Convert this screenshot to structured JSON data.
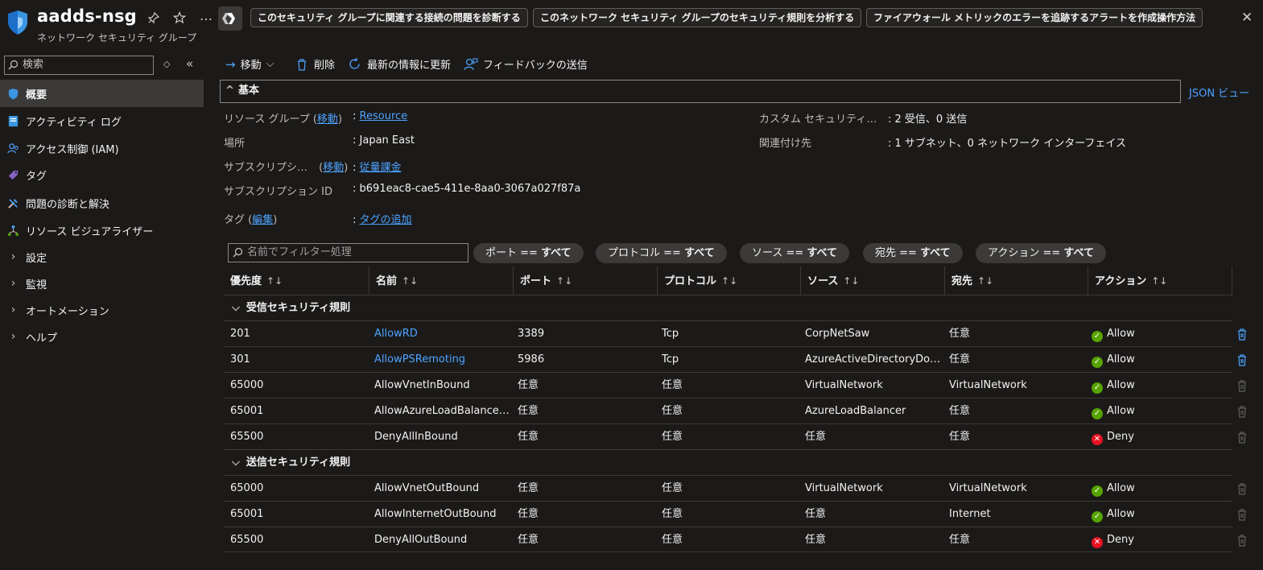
{
  "header": {
    "title": "aadds-nsg",
    "subtitle": "ネットワーク セキュリティ グループ",
    "more": "…",
    "close": "✕",
    "actions": [
      "このセキュリティ グループに関連する接続の問題を診断する",
      "このネットワーク セキュリティ グループのセキュリティ規則を分析する",
      "ファイアウォール メトリックのエラーを追跡するアラートを作成操作方法"
    ]
  },
  "sidebar": {
    "search_placeholder": "検索",
    "items": [
      {
        "label": "概要",
        "icon": "shield-icon"
      },
      {
        "label": "アクティビティ ログ",
        "icon": "activity-log-icon"
      },
      {
        "label": "アクセス制御 (IAM)",
        "icon": "iam-icon"
      },
      {
        "label": "タグ",
        "icon": "tag-icon"
      },
      {
        "label": "問題の診断と解決",
        "icon": "wrench-icon"
      },
      {
        "label": "リソース ビジュアライザー",
        "icon": "visualizer-icon"
      },
      {
        "label": "設定",
        "icon": "chevron-right-icon"
      },
      {
        "label": "監視",
        "icon": "chevron-right-icon"
      },
      {
        "label": "オートメーション",
        "icon": "chevron-right-icon"
      },
      {
        "label": "ヘルプ",
        "icon": "chevron-right-icon"
      }
    ]
  },
  "toolbar": {
    "move": "移動",
    "delete": "削除",
    "refresh": "最新の情報に更新",
    "feedback": "フィードバックの送信"
  },
  "essentials": {
    "title": "基本",
    "json_view": "JSON ビュー",
    "resource_group_label": "リソース グループ (",
    "move_link": "移動",
    "label_close": ")",
    "resource_group_value": "Resource",
    "location_label": "場所",
    "location_value": "Japan East",
    "subscription_label": "サブスクリプシ…",
    "subscription_move": "移動",
    "subscription_value": "従量課金",
    "subscription_id_label": "サブスクリプション ID",
    "subscription_id_value": "b691eac8-cae5-411e-8aa0-3067a027f87a",
    "tags_label": "タグ (",
    "tags_edit": "編集",
    "tags_value": "タグの追加",
    "custom_rules_label": "カスタム セキュリティ…",
    "custom_rules_value": "2 受信、0 送信",
    "associated_label": "関連付け先",
    "associated_value": "1 サブネット、0 ネットワーク インターフェイス",
    "colon": ":"
  },
  "filters": {
    "placeholder": "名前でフィルター処理",
    "pills": [
      {
        "key": "ポート == ",
        "value": "すべて"
      },
      {
        "key": "プロトコル == ",
        "value": "すべて"
      },
      {
        "key": "ソース == ",
        "value": "すべて"
      },
      {
        "key": "宛先 == ",
        "value": "すべて"
      },
      {
        "key": "アクション == ",
        "value": "すべて"
      }
    ]
  },
  "table": {
    "columns": [
      "優先度",
      "名前",
      "ポート",
      "プロトコル",
      "ソース",
      "宛先",
      "アクション"
    ],
    "sort_glyph": "↑↓",
    "groups": [
      {
        "label": "受信セキュリティ規則",
        "rows": [
          {
            "priority": "201",
            "name": "AllowRD",
            "port": "3389",
            "protocol": "Tcp",
            "source": "CorpNetSaw",
            "dest": "任意",
            "action": "Allow",
            "custom": true
          },
          {
            "priority": "301",
            "name": "AllowPSRemoting",
            "port": "5986",
            "protocol": "Tcp",
            "source": "AzureActiveDirectoryDo…",
            "dest": "任意",
            "action": "Allow",
            "custom": true
          },
          {
            "priority": "65000",
            "name": "AllowVnetInBound",
            "port": "任意",
            "protocol": "任意",
            "source": "VirtualNetwork",
            "dest": "VirtualNetwork",
            "action": "Allow",
            "custom": false
          },
          {
            "priority": "65001",
            "name": "AllowAzureLoadBalancer…",
            "port": "任意",
            "protocol": "任意",
            "source": "AzureLoadBalancer",
            "dest": "任意",
            "action": "Allow",
            "custom": false
          },
          {
            "priority": "65500",
            "name": "DenyAllInBound",
            "port": "任意",
            "protocol": "任意",
            "source": "任意",
            "dest": "任意",
            "action": "Deny",
            "custom": false
          }
        ]
      },
      {
        "label": "送信セキュリティ規則",
        "rows": [
          {
            "priority": "65000",
            "name": "AllowVnetOutBound",
            "port": "任意",
            "protocol": "任意",
            "source": "VirtualNetwork",
            "dest": "VirtualNetwork",
            "action": "Allow",
            "custom": false
          },
          {
            "priority": "65001",
            "name": "AllowInternetOutBound",
            "port": "任意",
            "protocol": "任意",
            "source": "任意",
            "dest": "Internet",
            "action": "Allow",
            "custom": false
          },
          {
            "priority": "65500",
            "name": "DenyAllOutBound",
            "port": "任意",
            "protocol": "任意",
            "source": "任意",
            "dest": "任意",
            "action": "Deny",
            "custom": false
          }
        ]
      }
    ]
  },
  "colors": {
    "accent": "#4da3ff",
    "allow": "#57a300",
    "deny": "#e81123",
    "background": "#1b1a19"
  }
}
